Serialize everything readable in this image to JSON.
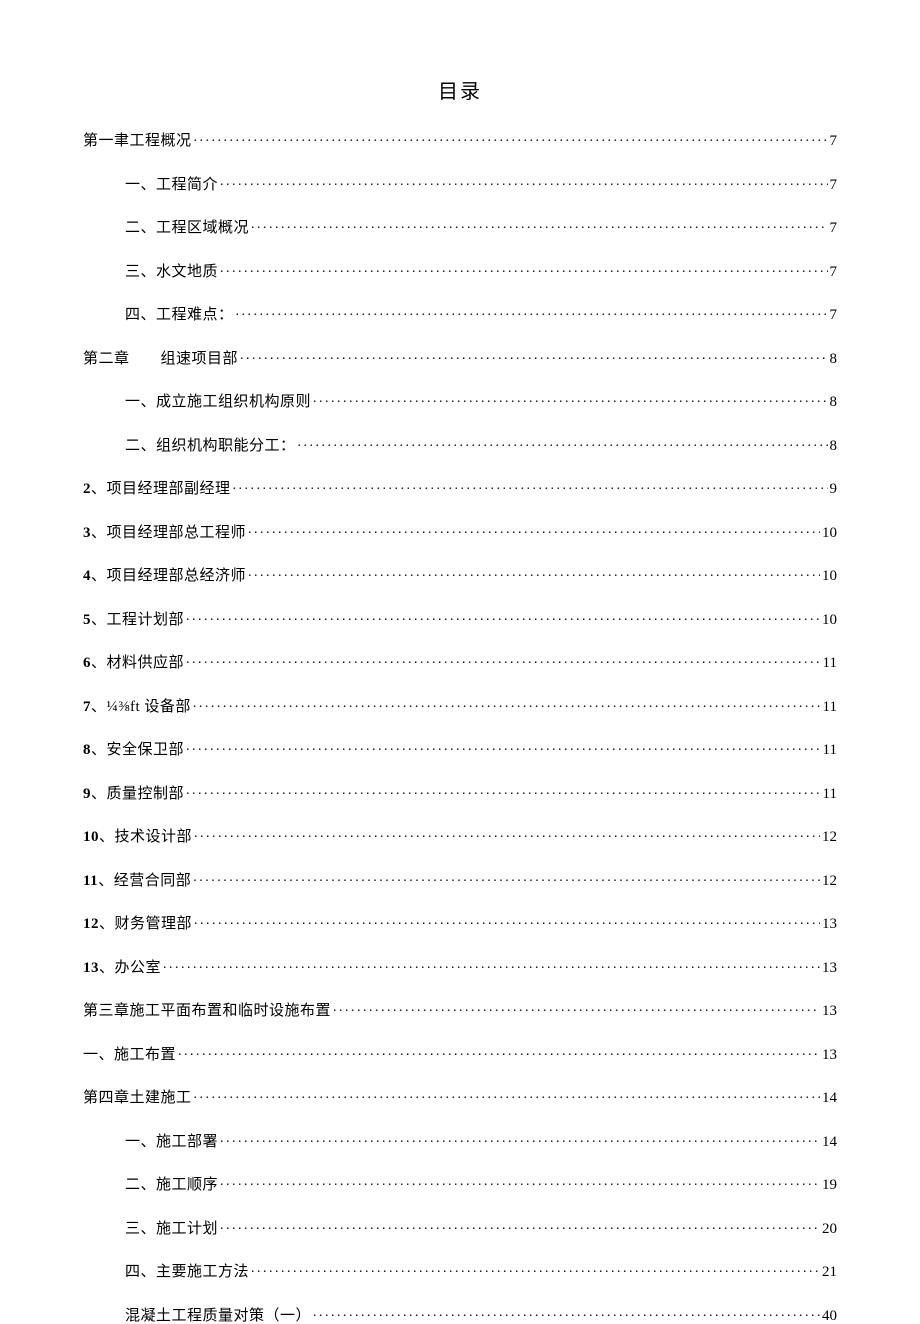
{
  "title": "目录",
  "entries": [
    {
      "indent": 0,
      "label": "第一聿工程概况",
      "page": "7"
    },
    {
      "indent": 1,
      "label": "一、工程简介",
      "page": "7"
    },
    {
      "indent": 1,
      "label": "二、工程区域概况",
      "page": "7"
    },
    {
      "indent": 1,
      "label": "三、水文地质",
      "page": "7"
    },
    {
      "indent": 1,
      "label": "四、工程难点：",
      "page": "7"
    },
    {
      "indent": 0,
      "label": "第二章　　组速项目部",
      "page": "8"
    },
    {
      "indent": 1,
      "label": "一、成立施工组织机构原则",
      "page": "8"
    },
    {
      "indent": 1,
      "label": "二、组织机构职能分工：",
      "page": "8"
    },
    {
      "indent": 0,
      "boldnum": "2",
      "label": "、项目经理部副经理",
      "page": "9"
    },
    {
      "indent": 0,
      "boldnum": "3",
      "label": "、项目经理部总工程师",
      "page": "10"
    },
    {
      "indent": 0,
      "boldnum": "4",
      "label": "、项目经理部总经济师",
      "page": "10"
    },
    {
      "indent": 0,
      "boldnum": "5",
      "label": "、工程计划部",
      "page": "10"
    },
    {
      "indent": 0,
      "boldnum": "6",
      "label": "、材料供应部",
      "page": "11"
    },
    {
      "indent": 0,
      "boldnum": "7",
      "label": "、¼⅜ft 设备部",
      "page": "11"
    },
    {
      "indent": 0,
      "boldnum": "8",
      "label": "、安全保卫部",
      "page": "11"
    },
    {
      "indent": 0,
      "boldnum": "9",
      "label": "、质量控制部",
      "page": "11"
    },
    {
      "indent": 0,
      "boldnum": "10",
      "label": "、技术设计部",
      "page": "12"
    },
    {
      "indent": 0,
      "boldnum": "11",
      "label": "、经营合同部",
      "page": "12"
    },
    {
      "indent": 0,
      "boldnum": "12",
      "label": "、财务管理部",
      "page": "13"
    },
    {
      "indent": 0,
      "boldnum": "13",
      "label": "、办公室",
      "page": "13"
    },
    {
      "indent": 0,
      "label": "第三章施工平面布置和临时设施布置",
      "page": "13"
    },
    {
      "indent": 0,
      "label": "一、施工布置",
      "page": "13"
    },
    {
      "indent": 0,
      "label": "第四章土建施工",
      "page": "14"
    },
    {
      "indent": 1,
      "label": "一、施工部署",
      "page": "14"
    },
    {
      "indent": 1,
      "label": "二、施工顺序",
      "page": "19"
    },
    {
      "indent": 1,
      "label": "三、施工计划",
      "page": "20"
    },
    {
      "indent": 1,
      "label": "四、主要施工方法",
      "page": "21"
    },
    {
      "indent": 1,
      "label": "混凝土工程质量对策（一）",
      "page": "40"
    }
  ]
}
